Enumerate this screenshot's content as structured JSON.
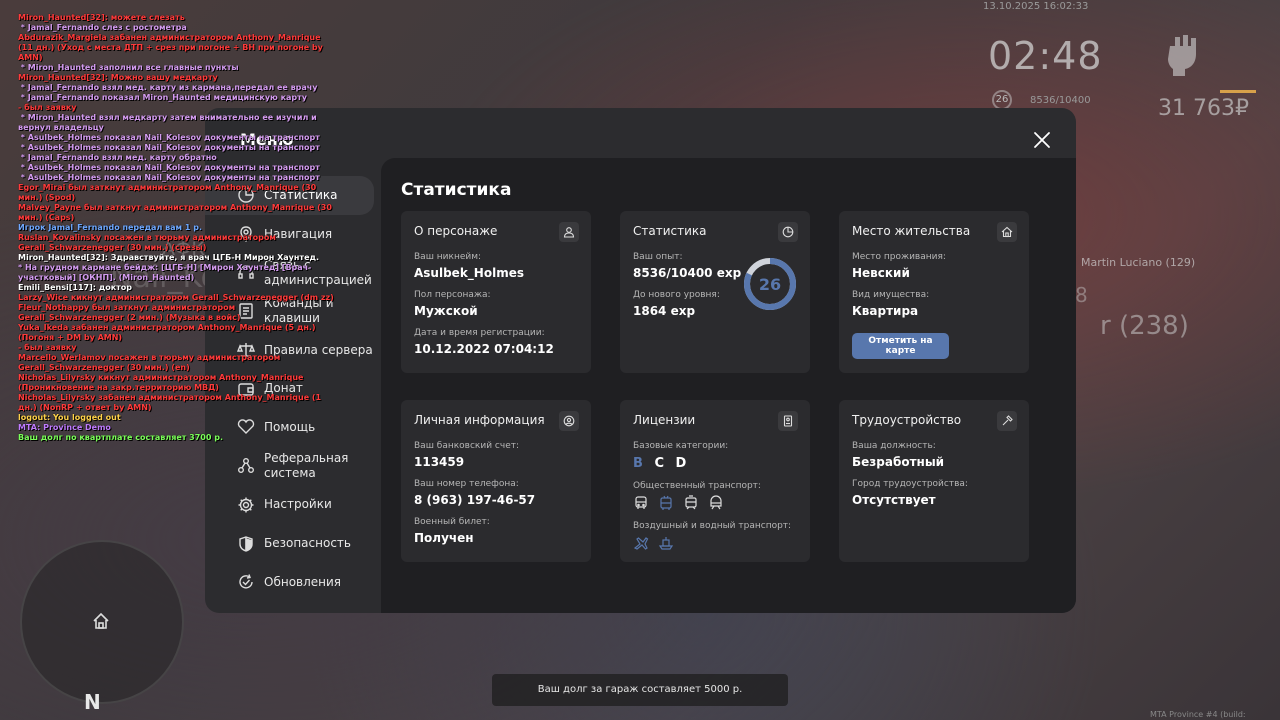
{
  "hud": {
    "date": "13.10.2025 16:02:33",
    "time": "02:48",
    "level": "26",
    "exp": "8536/10400",
    "money": "31 763₽",
    "nametag_1": "Martin Luciano (129)",
    "nametag_2": "r (238)",
    "nametag_3": "8",
    "afk_1": "АФК",
    "afk_2": "Nail_Kol",
    "minimap_north": "N",
    "build": "MTA Province #4 (build: 6.12420.9)",
    "debt_notice": "Ваш долг за гараж составляет 5000 р."
  },
  "chat": [
    {
      "text": "Miron_Haunted[32]: можете слезать",
      "color": "#ff3b3b"
    },
    {
      "text": " * Jamal_Fernando слез с ростометра",
      "color": "#d59cf0"
    },
    {
      "text": "Abdurazik_Margiela забанен администратором Anthony_Manrique (11 дн.) (Уход с места ДТП + срез при погоне + ВН при погоне by AMN)",
      "color": "#ff3b3b"
    },
    {
      "text": " * Miron_Haunted заполнил все главные пункты",
      "color": "#d59cf0"
    },
    {
      "text": "Miron_Haunted[32]: Можно вашу медкарту",
      "color": "#ff3b3b"
    },
    {
      "text": " * Jamal_Fernando взял мед. карту из кармана,передал ее врачу",
      "color": "#d59cf0"
    },
    {
      "text": " * Jamal_Fernando показал Miron_Haunted медицинскую карту",
      "color": "#d59cf0"
    },
    {
      "text": "- был заявку",
      "color": "#ff3b3b"
    },
    {
      "text": " * Miron_Haunted взял медкарту затем внимательно ее изучил и вернул владельцу",
      "color": "#d59cf0"
    },
    {
      "text": " * Asulbek_Holmes показал Nail_Kolesov документы на транспорт",
      "color": "#d59cf0"
    },
    {
      "text": " * Asulbek_Holmes показал Nail_Kolesov документы на транспорт",
      "color": "#d59cf0"
    },
    {
      "text": " * Jamal_Fernando взял мед. карту обратно",
      "color": "#d59cf0"
    },
    {
      "text": " * Asulbek_Holmes показал Nail_Kolesov документы на транспорт",
      "color": "#d59cf0"
    },
    {
      "text": " * Asulbek_Holmes показал Nail_Kolesov документы на транспорт",
      "color": "#d59cf0"
    },
    {
      "text": "Egor_Mirai был заткнут администратором Anthony_Manrique (30 мин.) (Spod)",
      "color": "#ff3b3b"
    },
    {
      "text": "Malvey_Payne был заткнут администратором Anthony_Manrique (30 мин.) (Caps)",
      "color": "#ff3b3b"
    },
    {
      "text": "Игрок Jamal_Fernando передал вам 1 р.",
      "color": "#6fa8ff"
    },
    {
      "text": "Ruslan_Kovalinsky посажен в тюрьму администратором Gerall_Schwarzenegger (30 мин.) (срезы)",
      "color": "#ff3b3b"
    },
    {
      "text": "Miron_Haunted[32]: Здравствуйте, я врач ЦГБ-Н Мирон Хаунтед.",
      "color": "#ffffff"
    },
    {
      "text": "* На грудном кармане бейдж: [ЦГБ-Н] [Мирон Хаунтед] [Врач-участковый] [ОКНП]. (Miron_Haunted)",
      "color": "#d59cf0"
    },
    {
      "text": "Emili_Bensi[117]: доктор",
      "color": "#ffffff"
    },
    {
      "text": "Larzy_Wice кикнут администратором Gerall_Schwarzenegger (dm zz)",
      "color": "#ff3b3b"
    },
    {
      "text": "Fleur_Nothappy был заткнут администратором Gerall_Schwarzenegger (2 мин.) (Музыка в войс)",
      "color": "#ff3b3b"
    },
    {
      "text": "Yuka_Ikeda забанен администратором Anthony_Manrique (5 дн.) (Погоня + DM by AMN)",
      "color": "#ff3b3b"
    },
    {
      "text": "- был заявку",
      "color": "#ff3b3b"
    },
    {
      "text": "Marcello_Werlamov посажен в тюрьму администратором Gerall_Schwarzenegger (30 мин.) (en)",
      "color": "#ff3b3b"
    },
    {
      "text": "Nicholas_Lilyrsky кикнут администратором Anthony_Manrique (Проникновение на закр.территорию МВД)",
      "color": "#ff3b3b"
    },
    {
      "text": "Nicholas_Lilyrsky забанен администратором Anthony_Manrique (1 дн.) (NonRP + ответ by AMN)",
      "color": "#ff3b3b"
    },
    {
      "text": "logout: You logged out",
      "color": "#ffd24a"
    },
    {
      "text": "MTA: Province Demo",
      "color": "#c07cff"
    },
    {
      "text": "Ваш долг по квартплате составляет 3700 р.",
      "color": "#7cff5a"
    }
  ],
  "menu": {
    "title": "Меню",
    "nav": [
      {
        "label": "Статистика",
        "icon": "stats-icon",
        "active": true
      },
      {
        "label": "Навигация",
        "icon": "navigation-icon"
      },
      {
        "label": "Связь с администрацией",
        "icon": "support-icon"
      },
      {
        "label": "Команды и клавиши",
        "icon": "commands-icon"
      },
      {
        "label": "Правила сервера",
        "icon": "rules-icon"
      },
      {
        "label": "Донат",
        "icon": "wallet-icon"
      },
      {
        "label": "Помощь",
        "icon": "help-icon"
      },
      {
        "label": "Реферальная система",
        "icon": "referral-icon"
      },
      {
        "label": "Настройки",
        "icon": "settings-icon"
      },
      {
        "label": "Безопасность",
        "icon": "security-icon"
      },
      {
        "label": "Обновления",
        "icon": "updates-icon"
      }
    ]
  },
  "stats": {
    "title": "Статистика",
    "character": {
      "title": "О персонаже",
      "nickname_label": "Ваш никнейм:",
      "nickname": "Asulbek_Holmes",
      "gender_label": "Пол персонажа:",
      "gender": "Мужской",
      "reg_label": "Дата и время регистрации:",
      "reg_date": "10.12.2022 07:04:12"
    },
    "stats_card": {
      "title": "Статистика",
      "exp_label": "Ваш опыт:",
      "exp": "8536/10400 exp",
      "next_label": "До нового уровня:",
      "next": "1864 exp",
      "level": "26",
      "level_progress": 0.82
    },
    "residence": {
      "title": "Место жительства",
      "place_label": "Место проживания:",
      "place": "Невский",
      "property_label": "Вид имущества:",
      "property": "Квартира",
      "map_button": "Отметить на карте"
    },
    "personal": {
      "title": "Личная информация",
      "bank_label": "Ваш банковский счет:",
      "bank": "113459",
      "phone_label": "Ваш номер телефона:",
      "phone": "8 (963) 197-46-57",
      "military_label": "Военный билет:",
      "military": "Получен"
    },
    "licenses": {
      "title": "Лицензии",
      "base_label": "Базовые категории:",
      "cat_b": "B",
      "cat_c": "C",
      "cat_d": "D",
      "public_label": "Общественный транспорт:",
      "air_label": "Воздушный и водный транспорт:"
    },
    "employment": {
      "title": "Трудоустройство",
      "position_label": "Ваша должность:",
      "position": "Безработный",
      "city_label": "Город трудоустройства:",
      "city": "Отсутствует"
    }
  },
  "colors": {
    "accent": "#5877ad",
    "panel": "#2c2c2f",
    "content": "#1f1f22",
    "card": "#2b2b2e"
  }
}
